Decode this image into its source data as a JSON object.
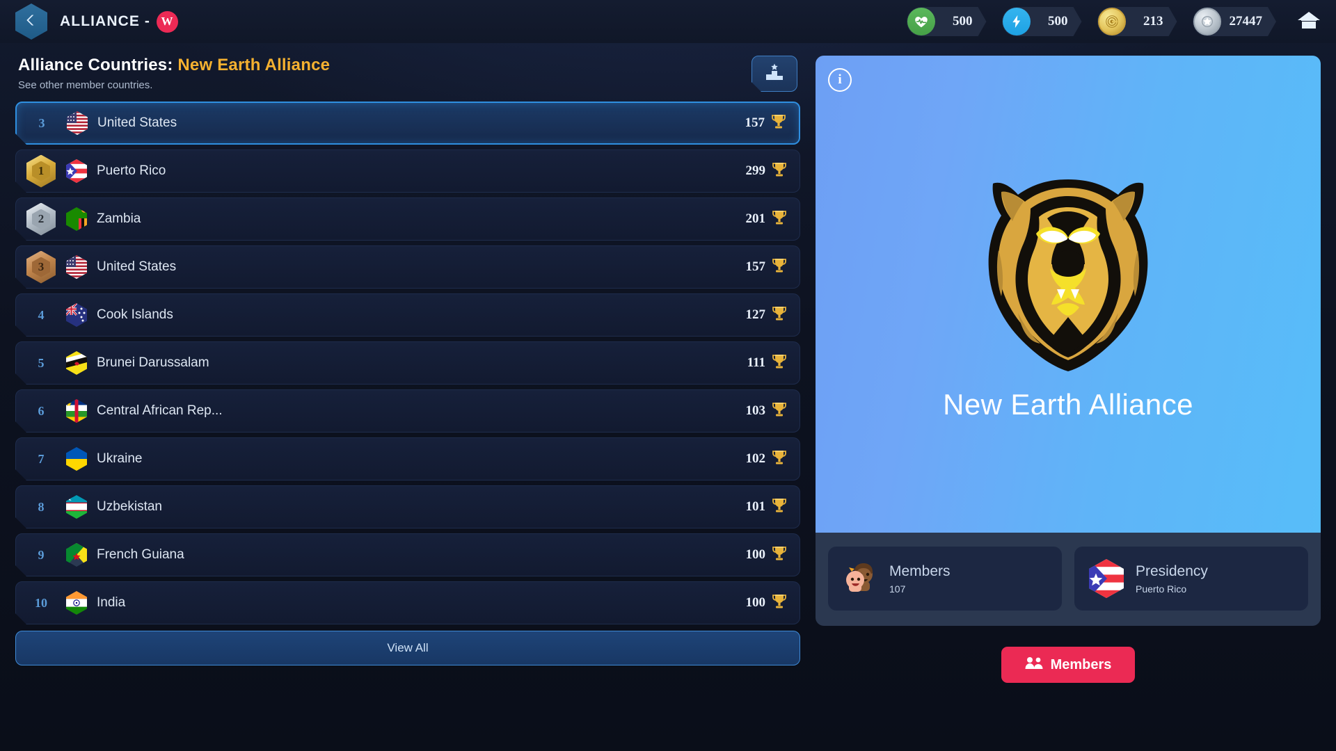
{
  "header": {
    "back_icon": "chevron-left-icon",
    "title": "ALLIANCE -",
    "badge_letter": "W",
    "home_icon": "home-icon",
    "resources": [
      {
        "id": "health",
        "icon": "heartbeat-icon",
        "value": "500"
      },
      {
        "id": "energy",
        "icon": "lightning-bolt-icon",
        "value": "500"
      },
      {
        "id": "gold",
        "icon": "gold-coin-icon",
        "value": "213"
      },
      {
        "id": "star",
        "icon": "silver-star-coin-icon",
        "value": "27447"
      }
    ]
  },
  "left_panel": {
    "title_prefix": "Alliance Countries:",
    "title_alliance": "New Earth Alliance",
    "subtitle": "See other member countries.",
    "podium_icon": "podium-ranking-icon",
    "view_all_label": "View All",
    "rows": [
      {
        "rank": "3",
        "medal": "",
        "country": "United States",
        "score": "157",
        "active": true,
        "flag": "us"
      },
      {
        "rank": "1",
        "medal": "gold",
        "country": "Puerto Rico",
        "score": "299",
        "active": false,
        "flag": "pr"
      },
      {
        "rank": "2",
        "medal": "silver",
        "country": "Zambia",
        "score": "201",
        "active": false,
        "flag": "zm"
      },
      {
        "rank": "3",
        "medal": "bronze",
        "country": "United States",
        "score": "157",
        "active": false,
        "flag": "us"
      },
      {
        "rank": "4",
        "medal": "",
        "country": "Cook Islands",
        "score": "127",
        "active": false,
        "flag": "ck"
      },
      {
        "rank": "5",
        "medal": "",
        "country": "Brunei Darussalam",
        "score": "111",
        "active": false,
        "flag": "bn"
      },
      {
        "rank": "6",
        "medal": "",
        "country": "Central African Rep...",
        "score": "103",
        "active": false,
        "flag": "cf"
      },
      {
        "rank": "7",
        "medal": "",
        "country": "Ukraine",
        "score": "102",
        "active": false,
        "flag": "ua"
      },
      {
        "rank": "8",
        "medal": "",
        "country": "Uzbekistan",
        "score": "101",
        "active": false,
        "flag": "uz"
      },
      {
        "rank": "9",
        "medal": "",
        "country": "French Guiana",
        "score": "100",
        "active": false,
        "flag": "gf"
      },
      {
        "rank": "10",
        "medal": "",
        "country": "India",
        "score": "100",
        "active": false,
        "flag": "in"
      }
    ]
  },
  "right_panel": {
    "info_icon": "info-circle-icon",
    "logo_icon": "lion-head-logo",
    "alliance_name": "New Earth Alliance",
    "stats": [
      {
        "id": "members",
        "icon": "people-icon",
        "label": "Members",
        "value": "107"
      },
      {
        "id": "presidency",
        "icon": "puerto-rico-flag-icon",
        "label": "Presidency",
        "value": "Puerto Rico"
      }
    ],
    "members_button": {
      "icon": "users-group-icon",
      "label": "Members"
    }
  },
  "colors": {
    "accent_gold": "#f5b130",
    "accent_blue": "#2f8fe0",
    "members_red": "#eb2a54",
    "panel_bg": "#2b3850",
    "row_bg": "#16203a"
  }
}
